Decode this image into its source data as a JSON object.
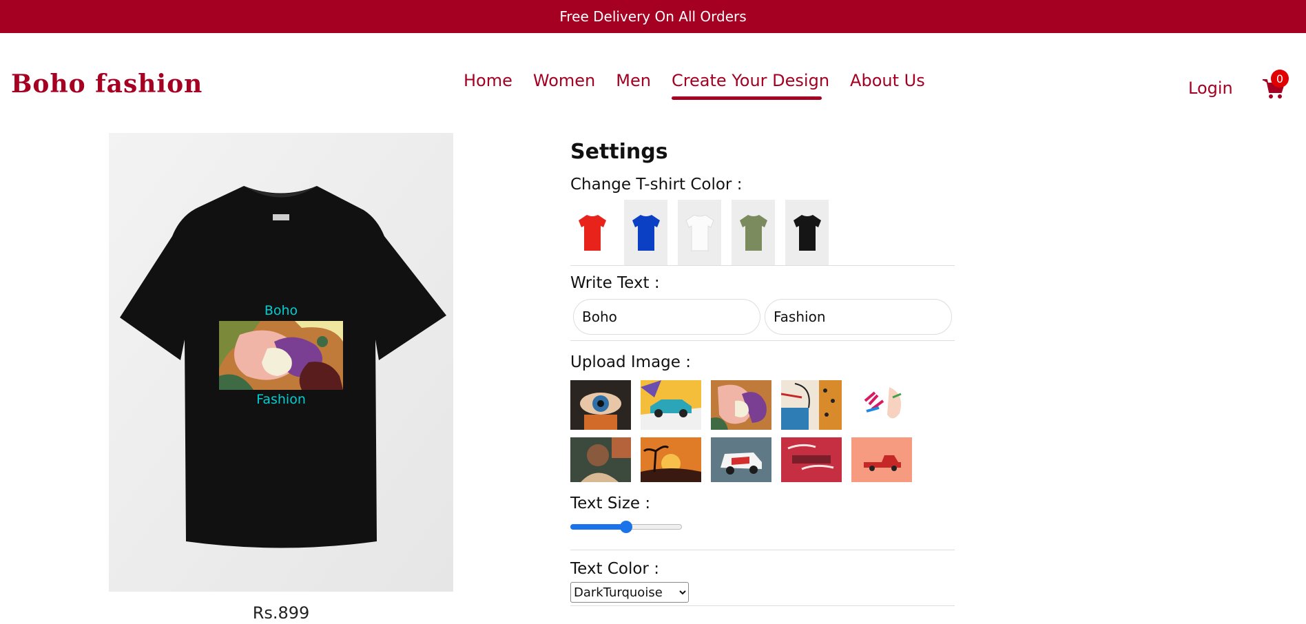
{
  "banner": {
    "text": "Free Delivery On All Orders"
  },
  "brand": {
    "name": "Boho fashion",
    "color": "#a50021"
  },
  "nav": {
    "items": [
      {
        "label": "Home"
      },
      {
        "label": "Women"
      },
      {
        "label": "Men"
      },
      {
        "label": "Create Your Design"
      },
      {
        "label": "About Us"
      }
    ],
    "active": "Create Your Design"
  },
  "header": {
    "login": "Login",
    "cart_count": "0",
    "cart_icon": "shopping-cart-icon"
  },
  "preview": {
    "top_text": "Boho",
    "bottom_text": "Fashion",
    "text_color": "#00ced1",
    "shirt_color": "#111111",
    "price": "Rs.899"
  },
  "settings": {
    "title": "Settings",
    "color_label": "Change T-shirt Color :",
    "colors": [
      {
        "name": "red",
        "hex": "#e8231c"
      },
      {
        "name": "blue",
        "hex": "#0b3fc4"
      },
      {
        "name": "white",
        "hex": "#f4f4f4"
      },
      {
        "name": "olive",
        "hex": "#7c8b5e"
      },
      {
        "name": "black",
        "hex": "#151515"
      }
    ],
    "text_label": "Write Text :",
    "text1": "Boho",
    "text2": "Fashion",
    "image_label": "Upload Image :",
    "images": [
      "eye-art",
      "car-art",
      "abstract-art",
      "face-pattern-art",
      "brush-face-art",
      "portrait-art",
      "sunset-tree-art",
      "van-art",
      "enjoy-the-ride-art",
      "red-truck-art"
    ],
    "size_label": "Text Size :",
    "size_value_fraction": 0.5,
    "text_color_label": "Text Color :",
    "text_color_value": "DarkTurquoise"
  }
}
